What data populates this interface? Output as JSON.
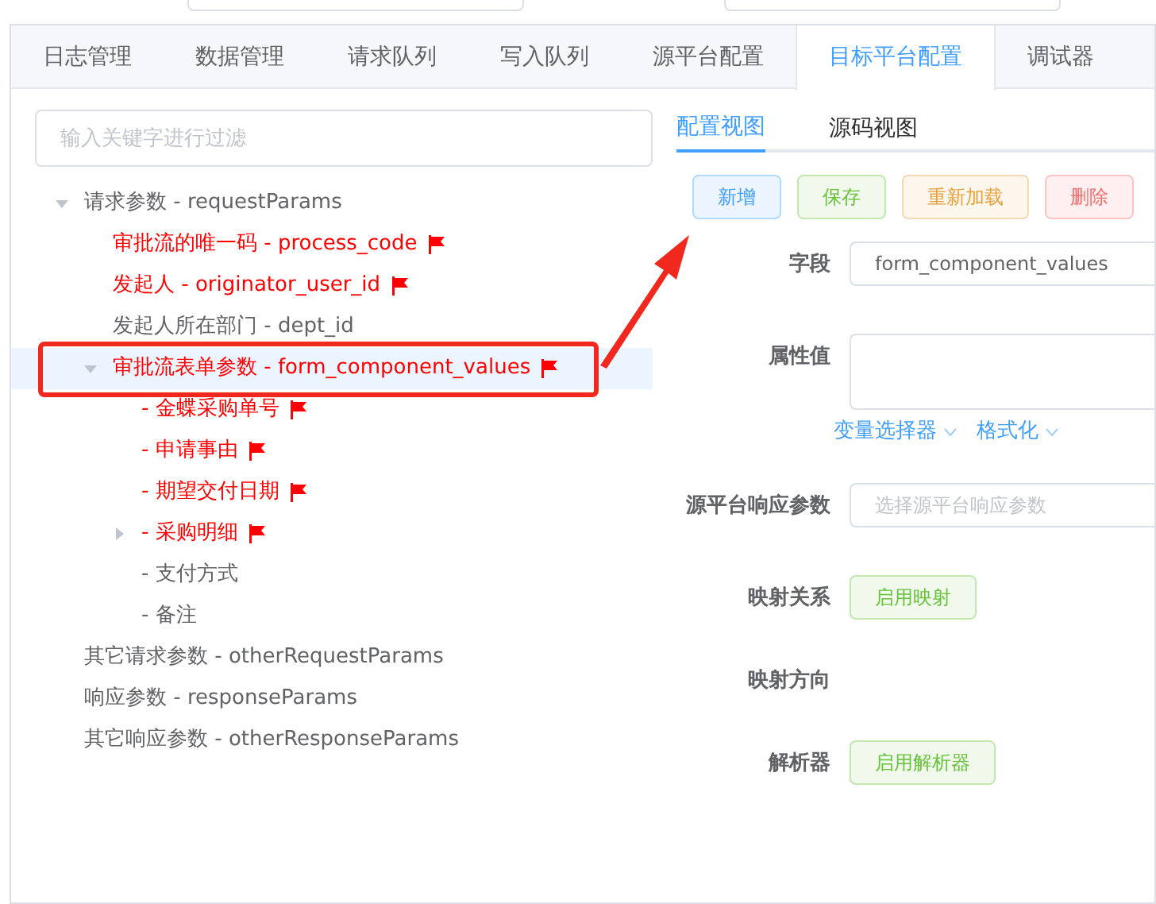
{
  "tabs": [
    {
      "label": "日志管理",
      "selected": false
    },
    {
      "label": "数据管理",
      "selected": false
    },
    {
      "label": "请求队列",
      "selected": false
    },
    {
      "label": "写入队列",
      "selected": false
    },
    {
      "label": "源平台配置",
      "selected": false
    },
    {
      "label": "目标平台配置",
      "selected": true
    },
    {
      "label": "调试器",
      "selected": false
    }
  ],
  "filter": {
    "placeholder": "输入关键字进行过滤"
  },
  "tree": [
    {
      "label": "请求参数 - requestParams",
      "required": false,
      "selected": false,
      "expanded": true,
      "children": [
        {
          "label": "审批流的唯一码 - process_code",
          "required": true,
          "selected": false
        },
        {
          "label": "发起人 - originator_user_id",
          "required": true,
          "selected": false
        },
        {
          "label": "发起人所在部门 - dept_id",
          "required": false,
          "selected": false
        },
        {
          "label": "审批流表单参数 - form_component_values",
          "required": true,
          "selected": true,
          "expanded": true,
          "children": [
            {
              "label": "- 金蝶采购单号",
              "required": true,
              "selected": false
            },
            {
              "label": "- 申请事由",
              "required": true,
              "selected": false
            },
            {
              "label": "- 期望交付日期",
              "required": true,
              "selected": false
            },
            {
              "label": "- 采购明细",
              "required": true,
              "selected": false,
              "expanded": false
            },
            {
              "label": "- 支付方式",
              "required": false,
              "selected": false
            },
            {
              "label": "- 备注",
              "required": false,
              "selected": false
            }
          ]
        }
      ]
    },
    {
      "label": "其它请求参数 - otherRequestParams",
      "required": false,
      "selected": false
    },
    {
      "label": "响应参数 - responseParams",
      "required": false,
      "selected": false
    },
    {
      "label": "其它响应参数 - otherResponseParams",
      "required": false,
      "selected": false
    }
  ],
  "view_tabs": [
    {
      "label": "配置视图",
      "selected": true
    },
    {
      "label": "源码视图",
      "selected": false
    }
  ],
  "actions": [
    {
      "label": "新增",
      "kind": "primary"
    },
    {
      "label": "保存",
      "kind": "success"
    },
    {
      "label": "重新加载",
      "kind": "warning"
    },
    {
      "label": "删除",
      "kind": "danger"
    }
  ],
  "form": [
    {
      "label": "字段",
      "kind": "input",
      "value": "form_component_values"
    },
    {
      "label": "属性值",
      "kind": "textarea",
      "links": [
        "变量选择器",
        "格式化"
      ]
    },
    {
      "label": "源平台响应参数",
      "kind": "select",
      "placeholder": "选择源平台响应参数"
    },
    {
      "label": "映射关系",
      "kind": "button",
      "button": "启用映射"
    },
    {
      "label": "映射方向",
      "kind": "empty"
    },
    {
      "label": "解析器",
      "kind": "button",
      "button": "启用解析器"
    }
  ]
}
